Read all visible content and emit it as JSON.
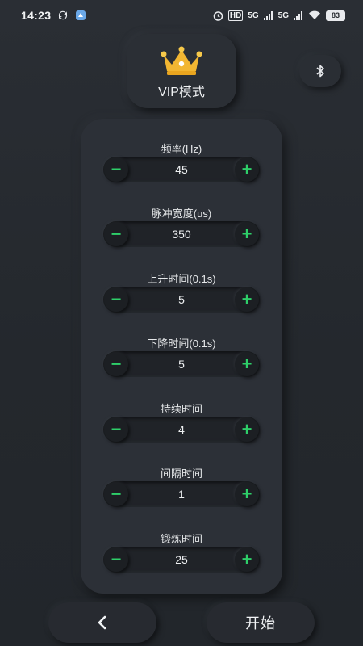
{
  "status_bar": {
    "time": "14:23",
    "network_hd": "HD",
    "network_5g_1": "5G",
    "network_5g_2": "5G",
    "battery": "83"
  },
  "header": {
    "vip_label": "VIP模式",
    "vip_icon": "crown-icon",
    "bluetooth_icon": "bluetooth-icon"
  },
  "params": [
    {
      "label": "频率(Hz)",
      "value": "45"
    },
    {
      "label": "脉冲宽度(us)",
      "value": "350"
    },
    {
      "label": "上升时间(0.1s)",
      "value": "5"
    },
    {
      "label": "下降时间(0.1s)",
      "value": "5"
    },
    {
      "label": "持续时间",
      "value": "4"
    },
    {
      "label": "间隔时间",
      "value": "1"
    },
    {
      "label": "锻炼时间",
      "value": "25"
    }
  ],
  "stepper": {
    "minus": "−",
    "plus": "+"
  },
  "footer": {
    "back_icon": "chevron-left-icon",
    "start_label": "开始"
  },
  "colors": {
    "accent": "#2ecf69",
    "crown_gold": "#f2b632",
    "background": "#262a30"
  }
}
